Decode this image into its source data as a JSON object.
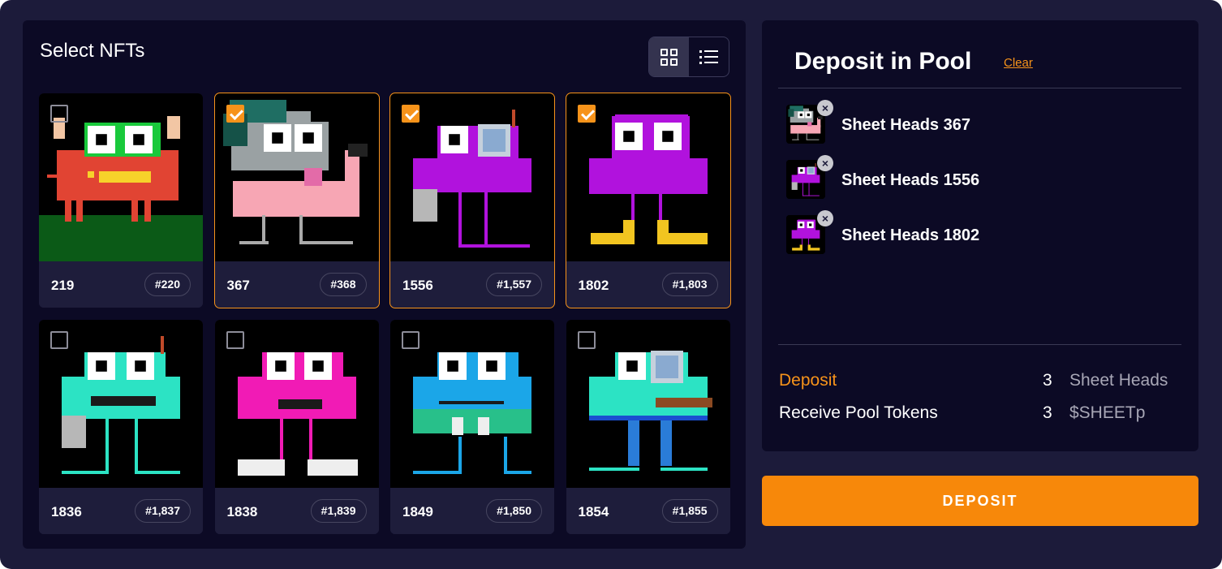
{
  "select_panel": {
    "title": "Select NFTs",
    "view_modes": [
      {
        "name": "grid-view",
        "icon": "grid-icon",
        "active": true
      },
      {
        "name": "list-view",
        "icon": "list-icon",
        "active": false
      }
    ],
    "nfts": [
      {
        "id": "219",
        "tag": "#220",
        "selected": false,
        "art": "red-horned"
      },
      {
        "id": "367",
        "tag": "#368",
        "selected": true,
        "art": "grey-flamingo"
      },
      {
        "id": "1556",
        "tag": "#1,557",
        "selected": true,
        "art": "purple-monocle"
      },
      {
        "id": "1802",
        "tag": "#1,803",
        "selected": true,
        "art": "purple-boots"
      },
      {
        "id": "1836",
        "tag": "#1,837",
        "selected": false,
        "art": "teal-mustache"
      },
      {
        "id": "1838",
        "tag": "#1,839",
        "selected": false,
        "art": "pink-sneakers"
      },
      {
        "id": "1849",
        "tag": "#1,850",
        "selected": false,
        "art": "blue-frog"
      },
      {
        "id": "1854",
        "tag": "#1,855",
        "selected": false,
        "art": "teal-cigar"
      }
    ]
  },
  "deposit_panel": {
    "title": "Deposit in Pool",
    "clear_label": "Clear",
    "selected_items": [
      {
        "name": "Sheet Heads 367",
        "art": "grey-flamingo"
      },
      {
        "name": "Sheet Heads 1556",
        "art": "purple-monocle"
      },
      {
        "name": "Sheet Heads 1802",
        "art": "purple-boots"
      }
    ],
    "remove_icon": "close-icon",
    "summary": [
      {
        "label": "Deposit",
        "qty": "3",
        "unit": "Sheet Heads",
        "label_color": "#f7931a"
      },
      {
        "label": "Receive Pool Tokens",
        "qty": "3",
        "unit": "$SHEETp",
        "label_color": "#ffffff"
      }
    ]
  },
  "deposit_button": {
    "label": "DEPOSIT"
  },
  "colors": {
    "accent": "#f7931a",
    "background": "#1c1b3a",
    "panel": "#0c0a25",
    "card_footer": "#1e1d3b"
  }
}
